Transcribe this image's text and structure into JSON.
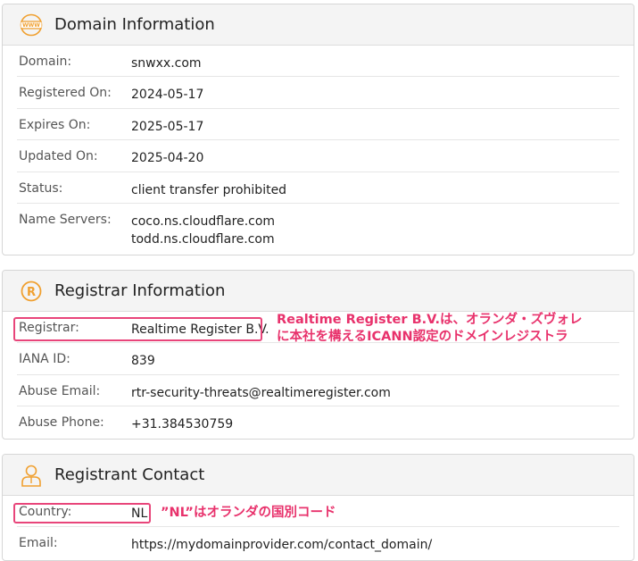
{
  "domain_info": {
    "title": "Domain Information",
    "icon": "www-icon",
    "rows": [
      {
        "label": "Domain:",
        "value": "snwxx.com"
      },
      {
        "label": "Registered On:",
        "value": "2024-05-17"
      },
      {
        "label": "Expires On:",
        "value": "2025-05-17"
      },
      {
        "label": "Updated On:",
        "value": "2025-04-20"
      },
      {
        "label": "Status:",
        "value": "client transfer prohibited"
      },
      {
        "label": "Name Servers:",
        "value1": "coco.ns.cloudflare.com",
        "value2": "todd.ns.cloudflare.com"
      }
    ]
  },
  "registrar_info": {
    "title": "Registrar Information",
    "icon": "registered-icon",
    "rows": [
      {
        "label": "Registrar:",
        "value": "Realtime Register B.V."
      },
      {
        "label": "IANA ID:",
        "value": "839"
      },
      {
        "label": "Abuse Email:",
        "value": "rtr-security-threats@realtimeregister.com"
      },
      {
        "label": "Abuse Phone:",
        "value": "+31.384530759"
      }
    ],
    "annotation": {
      "line1": "Realtime Register B.V.は、オランダ・ズヴォレ",
      "line2": "に本社を構えるICANN認定のドメインレジストラ"
    }
  },
  "registrant_contact": {
    "title": "Registrant Contact",
    "icon": "person-icon",
    "rows": [
      {
        "label": "Country:",
        "value": "NL"
      },
      {
        "label": "Email:",
        "value": "https://mydomainprovider.com/contact_domain/"
      }
    ],
    "annotation": "”NL”はオランダの国別コード"
  },
  "colors": {
    "accent_orange": "#f0a030",
    "highlight_pink": "#e8457a",
    "annotation_text": "#e8326c"
  }
}
